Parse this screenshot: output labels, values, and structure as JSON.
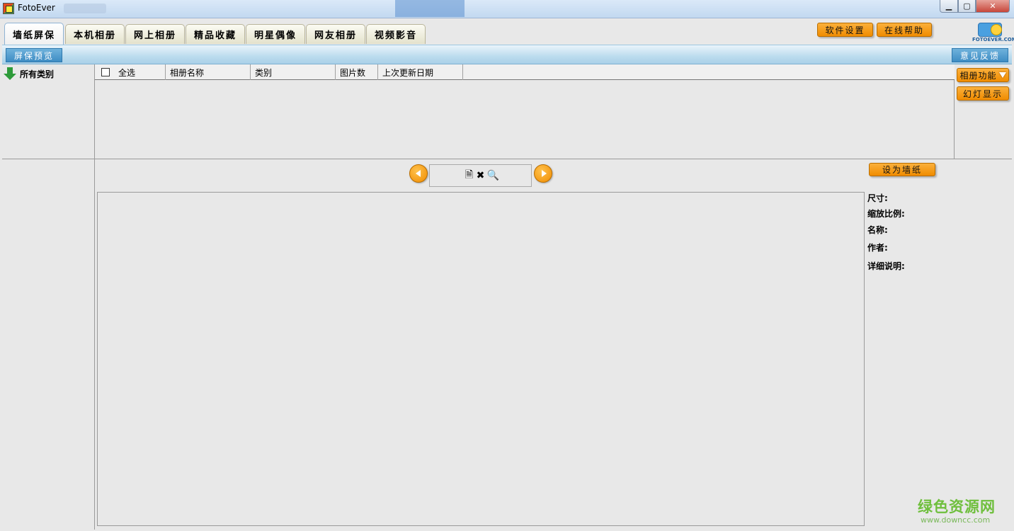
{
  "window": {
    "title": "FotoEver",
    "minimize": "▁",
    "maximize": "▢",
    "close": "✕"
  },
  "tabs": [
    "墙纸屏保",
    "本机相册",
    "网上相册",
    "精品收藏",
    "明星偶像",
    "网友相册",
    "视频影音"
  ],
  "toolbar": {
    "settings": "软件设置",
    "help": "在线帮助",
    "logo_text": "FOTOEVER.COM"
  },
  "subbar": {
    "preview": "屏保预览",
    "feedback": "意见反馈"
  },
  "sidebar": {
    "all_categories": "所有类别"
  },
  "list": {
    "columns": [
      "全选",
      "相册名称",
      "类别",
      "图片数",
      "上次更新日期"
    ],
    "rows": []
  },
  "side_buttons": {
    "album_functions": "相册功能",
    "slideshow": "幻灯显示"
  },
  "viewer": {
    "set_wallpaper": "设为墙纸",
    "tool_icons": [
      "document-icon",
      "delete-icon",
      "zoom-icon"
    ],
    "info_labels": {
      "size": "尺寸:",
      "scale": "缩放比例:",
      "name": "名称:",
      "author": "作者:",
      "details": "详细说明:"
    }
  },
  "watermark": {
    "cn": "绿色资源网",
    "url": "www.downcc.com"
  },
  "colors": {
    "accent_orange": "#f08c00",
    "subbar_blue": "#3e8dc4",
    "watermark_green": "#6fbf3d"
  }
}
